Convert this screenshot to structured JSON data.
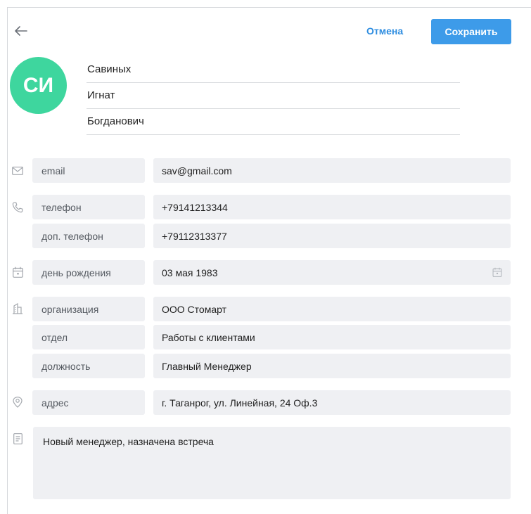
{
  "header": {
    "cancel_label": "Отмена",
    "save_label": "Сохранить"
  },
  "avatar": {
    "initials": "СИ",
    "color": "#3ed69e"
  },
  "name": {
    "last": "Савиных",
    "first": "Игнат",
    "middle": "Богданович"
  },
  "fields": {
    "email": {
      "label": "email",
      "value": "sav@gmail.com"
    },
    "phone": {
      "label": "телефон",
      "value": "+79141213344"
    },
    "extra_phone": {
      "label": "доп. телефон",
      "value": "+79112313377"
    },
    "birthday": {
      "label": "день рождения",
      "value": "03 мая 1983"
    },
    "organization": {
      "label": "организация",
      "value": "ООО Стомарт"
    },
    "department": {
      "label": "отдел",
      "value": "Работы с клиентами"
    },
    "position": {
      "label": "должность",
      "value": "Главный Менеджер"
    },
    "address": {
      "label": "адрес",
      "value": "г. Таганрог, ул. Линейная, 24 Оф.3"
    }
  },
  "notes": "Новый менеджер, назначена встреча",
  "colors": {
    "accent": "#3d9be9",
    "field_bg": "#eff0f3",
    "icon": "#a4a8ae"
  },
  "icons": [
    "back-arrow-icon",
    "mail-icon",
    "phone-icon",
    "calendar-icon",
    "building-icon",
    "location-icon",
    "note-icon"
  ]
}
